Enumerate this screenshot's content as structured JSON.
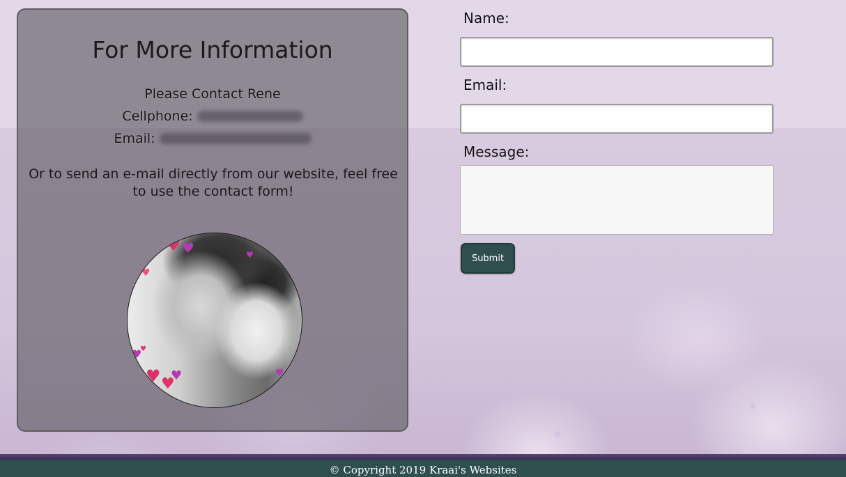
{
  "info": {
    "title": "For More Information",
    "contact_line": "Please Contact Rene",
    "cellphone_label": "Cellphone:",
    "email_label": "Email:",
    "note": "Or to send an e-mail directly from our website, feel free to use the contact form!"
  },
  "form": {
    "name_label": "Name:",
    "email_label": "Email:",
    "message_label": "Message:",
    "name_value": "",
    "email_value": "",
    "message_value": "",
    "submit_label": "Submit"
  },
  "footer": {
    "copyright": "© Copyright 2019 Kraai's Websites"
  },
  "colors": {
    "footer_bg": "#2f4f4f",
    "button_bg": "#2f4f4f",
    "page_bg": "#e2d8e8",
    "heart_colors": [
      "#e0316a",
      "#b43ab0",
      "#f0507a"
    ]
  }
}
